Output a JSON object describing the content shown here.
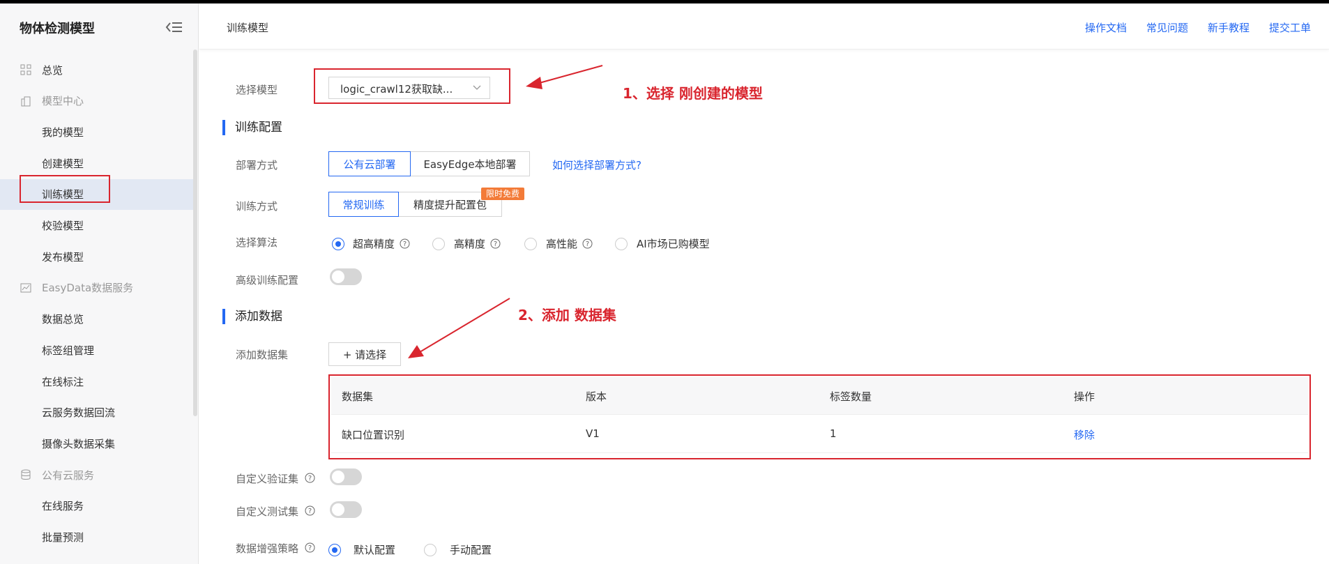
{
  "sidebar": {
    "title": "物体检测模型",
    "items": [
      {
        "label": "总览",
        "kind": "top",
        "icon": "grid-icon"
      },
      {
        "label": "模型中心",
        "kind": "group",
        "icon": "building-icon"
      },
      {
        "label": "我的模型",
        "kind": "sub"
      },
      {
        "label": "创建模型",
        "kind": "sub"
      },
      {
        "label": "训练模型",
        "kind": "sub",
        "active": true
      },
      {
        "label": "校验模型",
        "kind": "sub"
      },
      {
        "label": "发布模型",
        "kind": "sub"
      },
      {
        "label": "EasyData数据服务",
        "kind": "group",
        "icon": "chart-icon"
      },
      {
        "label": "数据总览",
        "kind": "sub"
      },
      {
        "label": "标签组管理",
        "kind": "sub"
      },
      {
        "label": "在线标注",
        "kind": "sub"
      },
      {
        "label": "云服务数据回流",
        "kind": "sub"
      },
      {
        "label": "摄像头数据采集",
        "kind": "sub"
      },
      {
        "label": "公有云服务",
        "kind": "group",
        "icon": "database-icon"
      },
      {
        "label": "在线服务",
        "kind": "sub"
      },
      {
        "label": "批量预测",
        "kind": "sub"
      }
    ]
  },
  "header": {
    "title": "训练模型",
    "links": [
      "操作文档",
      "常见问题",
      "新手教程",
      "提交工单"
    ]
  },
  "form": {
    "model_label": "选择模型",
    "model_value": "logic_crawl12获取缺...",
    "train_config_title": "训练配置",
    "deploy_label": "部署方式",
    "deploy_options": [
      "公有云部署",
      "EasyEdge本地部署"
    ],
    "deploy_help": "如何选择部署方式?",
    "train_label": "训练方式",
    "train_options": [
      "常规训练",
      "精度提升配置包"
    ],
    "free_badge": "限时免费",
    "algo_label": "选择算法",
    "algo_options": [
      "超高精度",
      "高精度",
      "高性能",
      "AI市场已购模型"
    ],
    "advanced_label": "高级训练配置",
    "add_data_title": "添加数据",
    "dataset_label": "添加数据集",
    "add_button": "+ 请选择",
    "table": {
      "headers": [
        "数据集",
        "版本",
        "标签数量",
        "操作"
      ],
      "rows": [
        [
          "缺口位置识别",
          "V1",
          "1",
          "移除"
        ]
      ]
    },
    "custom_val_label": "自定义验证集",
    "custom_test_label": "自定义测试集",
    "augment_label": "数据增强策略",
    "augment_options": [
      "默认配置",
      "手动配置"
    ]
  },
  "annotations": {
    "step1": "1、选择 刚创建的模型",
    "step2": "2、添加 数据集"
  },
  "colors": {
    "accent": "#2468f2",
    "annotation": "#d9252e",
    "badge": "#f37b38"
  }
}
